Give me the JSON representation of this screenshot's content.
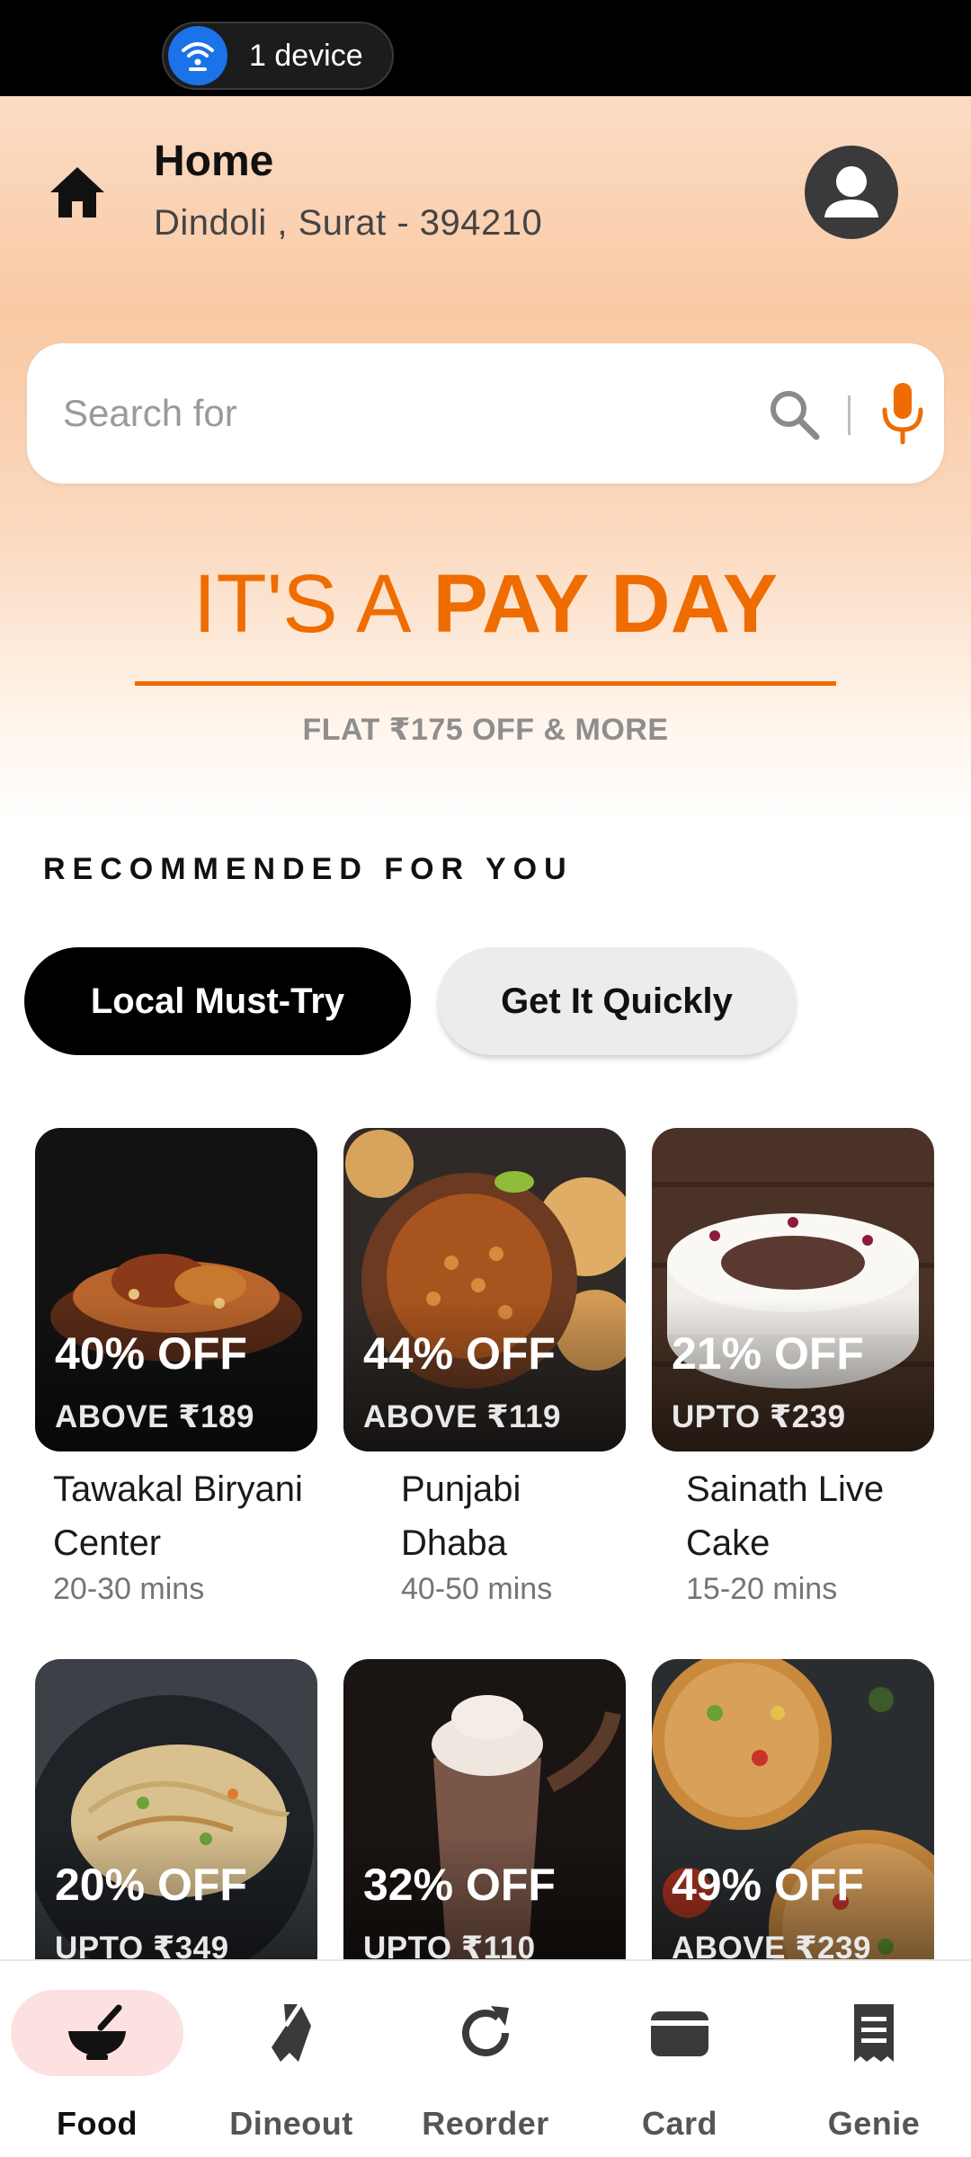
{
  "status_bar": {
    "device_label": "1 device"
  },
  "location": {
    "title": "Home",
    "address": "Dindoli , Surat  -  394210"
  },
  "search": {
    "placeholder": "Search for"
  },
  "promo": {
    "prefix": "IT'S A",
    "highlight": "PAY DAY",
    "subtitle": "FLAT ₹175 OFF & MORE"
  },
  "section": {
    "title": "RECOMMENDED FOR YOU"
  },
  "filters": [
    {
      "label": "Local Must-Try",
      "active": true
    },
    {
      "label": "Get It Quickly",
      "active": false
    }
  ],
  "restaurants": [
    {
      "discount": "40% OFF",
      "condition": "ABOVE ₹189",
      "name": "Tawakal Biryani Center",
      "time": "20-30 mins"
    },
    {
      "discount": "44% OFF",
      "condition": "ABOVE ₹119",
      "name": "Punjabi Dhaba",
      "time": "40-50 mins"
    },
    {
      "discount": "21% OFF",
      "condition": "UPTO ₹239",
      "name": "Sainath Live Cake",
      "time": "15-20 mins"
    },
    {
      "discount": "20% OFF",
      "condition": "UPTO ₹349",
      "name": "",
      "time": ""
    },
    {
      "discount": "32% OFF",
      "condition": "UPTO ₹110",
      "name": "",
      "time": ""
    },
    {
      "discount": "49% OFF",
      "condition": "ABOVE ₹239",
      "name": "",
      "time": ""
    }
  ],
  "bottom_nav": [
    {
      "label": "Food",
      "icon": "bowl-icon",
      "active": true
    },
    {
      "label": "Dineout",
      "icon": "ribbon-icon",
      "active": false
    },
    {
      "label": "Reorder",
      "icon": "refresh-icon",
      "active": false
    },
    {
      "label": "Card",
      "icon": "wallet-icon",
      "active": false
    },
    {
      "label": "Genie",
      "icon": "receipt-icon",
      "active": false
    }
  ],
  "colors": {
    "accent": "#ef6c00",
    "chip_active": "#000000",
    "nav_active_pill": "#fde1e1"
  }
}
